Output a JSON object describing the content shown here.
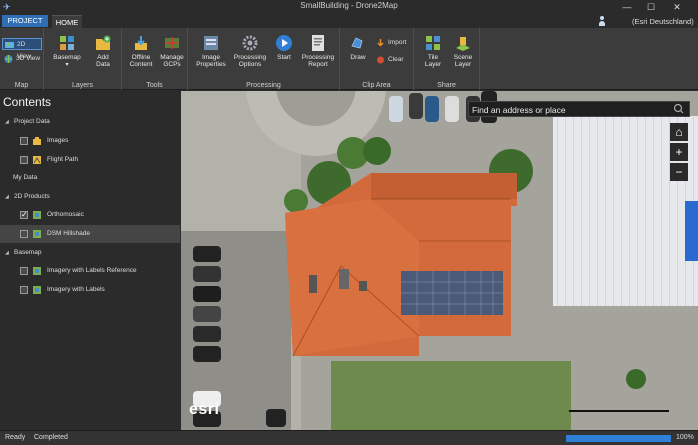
{
  "window": {
    "title": "SmallBuilding - Drone2Map"
  },
  "tabs": {
    "project": "PROJECT",
    "home": "HOME"
  },
  "user": {
    "name": "(Esri Deutschland)"
  },
  "ribbon": {
    "map": {
      "label": "Map",
      "view2d": "2D View",
      "view3d": "3D View"
    },
    "layers": {
      "label": "Layers",
      "basemap": "Basemap",
      "add_data": "Add Data"
    },
    "tools": {
      "label": "Tools",
      "offline": "Offline Content",
      "gcps": "Manage GCPs"
    },
    "processing": {
      "label": "Processing",
      "image_props": "Image Properties",
      "options": "Processing Options",
      "start": "Start",
      "report": "Processing Report"
    },
    "clip": {
      "label": "Clip Area",
      "draw": "Draw",
      "import": "Import",
      "clear": "Clear"
    },
    "share": {
      "label": "Share",
      "tile": "Tile Layer",
      "scene": "Scene Layer"
    }
  },
  "contents": {
    "title": "Contents",
    "groups": [
      {
        "label": "Project Data",
        "items": [
          "Images",
          "Flight Path"
        ]
      },
      {
        "label": "My Data",
        "items": []
      },
      {
        "label": "2D Products",
        "items": [
          "Orthomosaic",
          "DSM Hillshade"
        ]
      },
      {
        "label": "Basemap",
        "items": [
          "Imagery with Labels Reference",
          "Imagery with Labels"
        ]
      }
    ]
  },
  "map": {
    "search_placeholder": "Find an address or place",
    "home": "⌂",
    "zoom_in": "+",
    "zoom_out": "−",
    "logo": "esri"
  },
  "status": {
    "ready": "Ready",
    "completed": "Completed",
    "percent": "100%",
    "progress": 1.0
  },
  "colors": {
    "accent": "#2f6db5",
    "roof": "#d86a3e",
    "panel": "#4a5a78"
  }
}
